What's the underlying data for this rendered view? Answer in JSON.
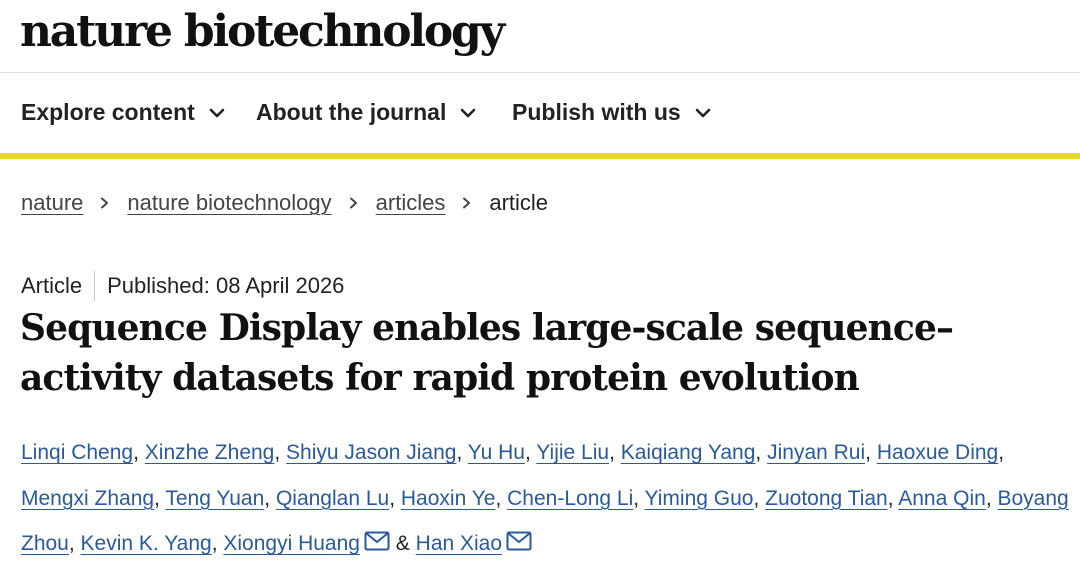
{
  "site": {
    "logo": "nature biotechnology"
  },
  "nav": {
    "items": [
      {
        "label": "Explore content",
        "icon": "chevron-down-icon"
      },
      {
        "label": "About the journal",
        "icon": "chevron-down-icon"
      },
      {
        "label": "Publish with us",
        "icon": "chevron-down-icon"
      }
    ]
  },
  "breadcrumb": {
    "items": [
      "nature",
      "nature biotechnology",
      "articles"
    ],
    "current": "article"
  },
  "article": {
    "type": "Article",
    "published": "Published: 08 April 2026",
    "title": "Sequence Display enables large-scale sequence–activity datasets for rapid protein evolution"
  },
  "authors": {
    "list": [
      "Linqi Cheng",
      "Xinzhe Zheng",
      "Shiyu Jason Jiang",
      "Yu Hu",
      "Yijie Liu",
      "Kaiqiang Yang",
      "Jinyan Rui",
      "Haoxue Ding",
      "Mengxi Zhang",
      "Teng Yuan",
      "Qianglan Lu",
      "Haoxin Ye",
      "Chen-Long Li",
      "Yiming Guo",
      "Zuotong Tian",
      "Anna Qin",
      "Boyang Zhou",
      "Kevin K. Yang",
      "Xiongyi Huang",
      "Han Xiao"
    ],
    "separator": ", ",
    "last_separator": " & ",
    "corresponding_icon": "email-icon"
  },
  "colors": {
    "accent": "#e8d52b",
    "link": "#2a5a9a",
    "text": "#222222"
  }
}
